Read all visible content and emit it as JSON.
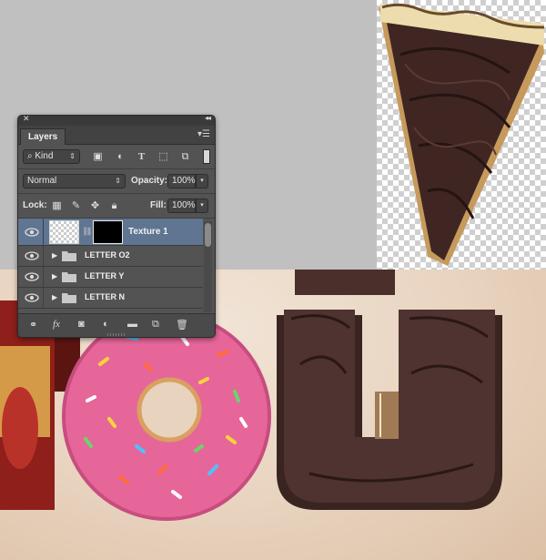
{
  "panel": {
    "tab_label": "Layers",
    "filter": {
      "value": "Kind",
      "icons": [
        "image-filter-icon",
        "adjustment-filter-icon",
        "type-filter-icon",
        "shape-filter-icon",
        "smart-object-filter-icon"
      ]
    },
    "blend_mode": "Normal",
    "opacity_label": "Opacity:",
    "opacity_value": "100%",
    "lock_label": "Lock:",
    "fill_label": "Fill:",
    "fill_value": "100%",
    "layers": [
      {
        "name": "Texture 1",
        "type": "layer",
        "selected": true,
        "visible": true
      },
      {
        "name": "LETTER O2",
        "type": "group",
        "selected": false,
        "visible": true
      },
      {
        "name": "LETTER Y",
        "type": "group",
        "selected": false,
        "visible": true
      },
      {
        "name": "LETTER N",
        "type": "group",
        "selected": false,
        "visible": true
      }
    ],
    "bottom_icons": [
      "link-icon",
      "fx-icon",
      "mask-icon",
      "adjustment-icon",
      "group-icon",
      "new-layer-icon",
      "trash-icon"
    ]
  },
  "colors": {
    "panel_bg": "#535353",
    "selection": "#5f7591",
    "canvas_gray": "#c0c0c0",
    "beige": "#e8d3bf",
    "chocolate": "#4b2f2b",
    "donut_pink": "#e6669a"
  }
}
